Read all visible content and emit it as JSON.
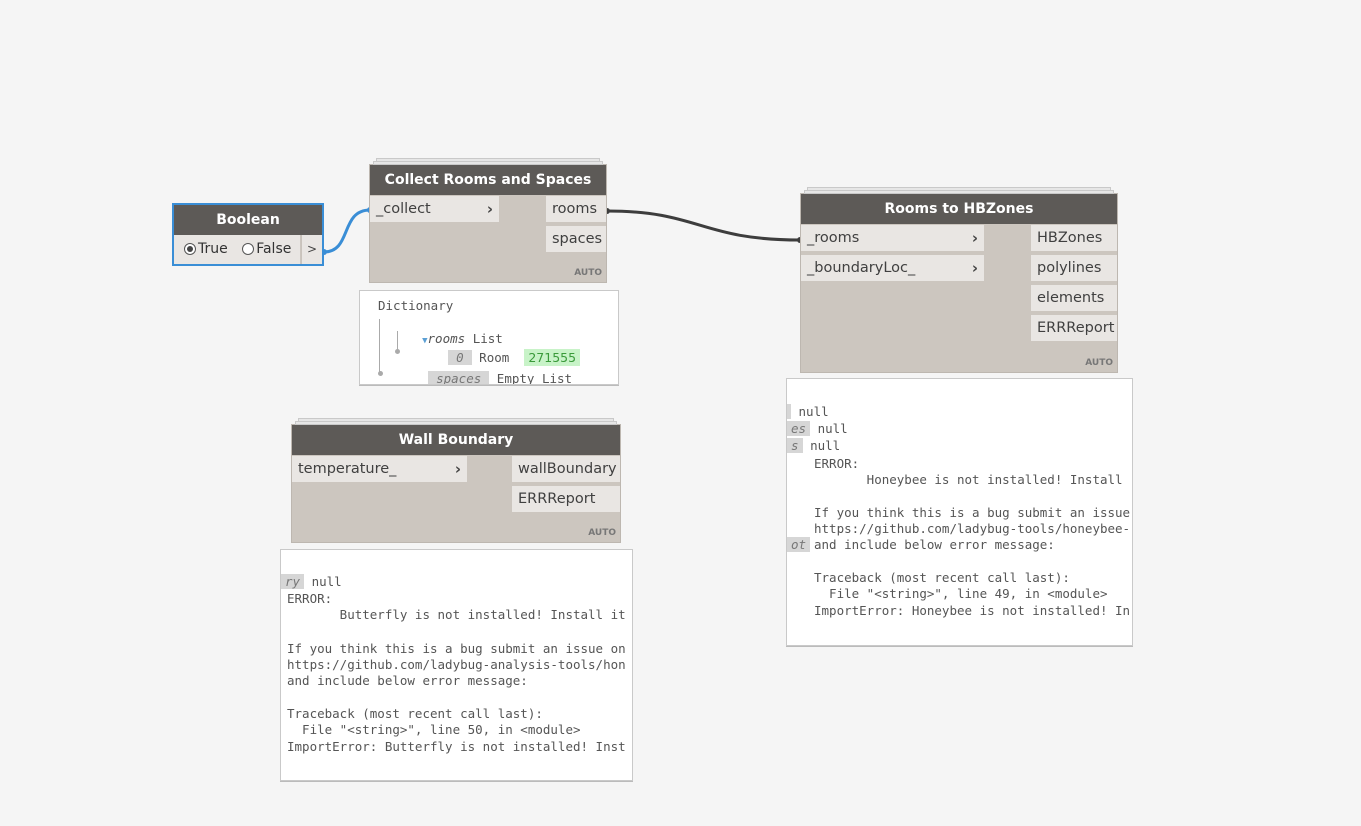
{
  "nodes": {
    "boolean": {
      "title": "Boolean",
      "option_true": "True",
      "option_false": "False",
      "output": ">",
      "selected": "True"
    },
    "collect": {
      "title": "Collect Rooms and Spaces",
      "inputs": [
        "_collect"
      ],
      "outputs": [
        "rooms",
        "spaces"
      ],
      "lacing": "AUTO"
    },
    "hbzones": {
      "title": "Rooms to HBZones",
      "inputs": [
        "_rooms",
        "_boundaryLoc_"
      ],
      "outputs": [
        "HBZones",
        "polylines",
        "elements",
        "ERRReport"
      ],
      "lacing": "AUTO"
    },
    "wall": {
      "title": "Wall Boundary",
      "inputs": [
        "temperature_"
      ],
      "outputs": [
        "wallBoundary",
        "ERRReport"
      ],
      "lacing": "AUTO"
    }
  },
  "previews": {
    "collect": {
      "root": "Dictionary",
      "rooms_key": "rooms",
      "rooms_type": "List",
      "index": "0",
      "item_type": "Room",
      "item_value": "271555",
      "spaces_key": "spaces",
      "spaces_value": "Empty List"
    },
    "hbzones": {
      "tag1": "",
      "val1": "null",
      "tag2": "es",
      "val2": "null",
      "tag3": "s",
      "val3": "null",
      "lines": [
        "ERROR:",
        "       Honeybee is not installed! Install",
        "",
        "If you think this is a bug submit an issue",
        "https://github.com/ladybug-tools/honeybee-",
        "and include below error message:",
        "",
        "Traceback (most recent call last):",
        "  File \"<string>\", line 49, in <module>",
        "ImportError: Honeybee is not installed! In"
      ],
      "tag4": "ot"
    },
    "wall": {
      "tag1": "ry",
      "val1": "null",
      "lines": [
        "ERROR:",
        "       Butterfly is not installed! Install it",
        "",
        "If you think this is a bug submit an issue on",
        "https://github.com/ladybug-analysis-tools/hon",
        "and include below error message:",
        "",
        "Traceback (most recent call last):",
        "  File \"<string>\", line 50, in <module>",
        "ImportError: Butterfly is not installed! Inst"
      ]
    }
  },
  "colors": {
    "canvas": "#f5f5f5",
    "node_header": "#5d5a57",
    "node_body": "#ccc6bf",
    "selected": "#3a8ed6",
    "wire": "#3d3d3d",
    "value_highlight": "#c8f3c8"
  }
}
